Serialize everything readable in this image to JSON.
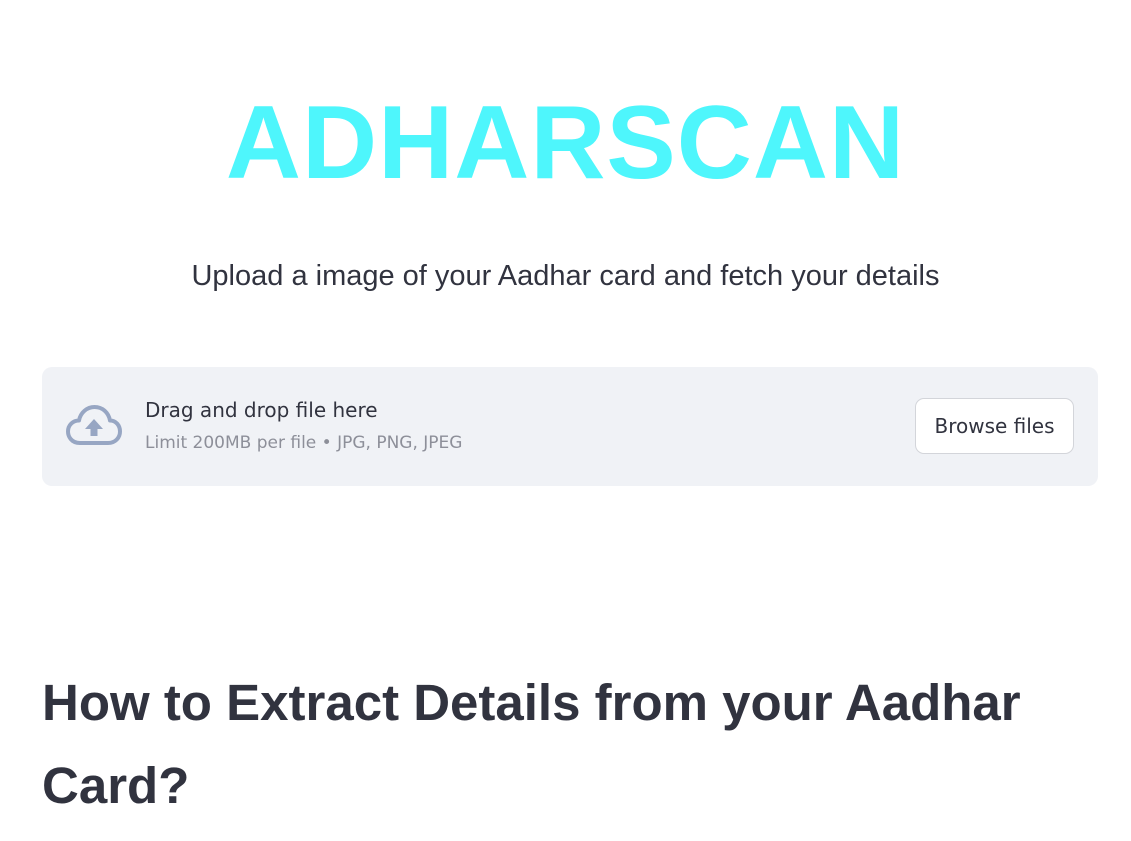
{
  "app": {
    "title": "ADHARSCAN",
    "subtitle": "Upload a image of your Aadhar card and fetch your details",
    "title_color": "#4ef6fc",
    "text_color": "#31333f"
  },
  "uploader": {
    "instructions": "Drag and drop file here",
    "limit": "Limit 200MB per file • JPG, PNG, JPEG",
    "button_label": "Browse files",
    "icon": "cloud-upload-icon",
    "background_color": "#f0f2f6",
    "icon_color": "#97a6c3"
  },
  "section": {
    "heading": "How to Extract Details from your Aadhar Card?"
  }
}
